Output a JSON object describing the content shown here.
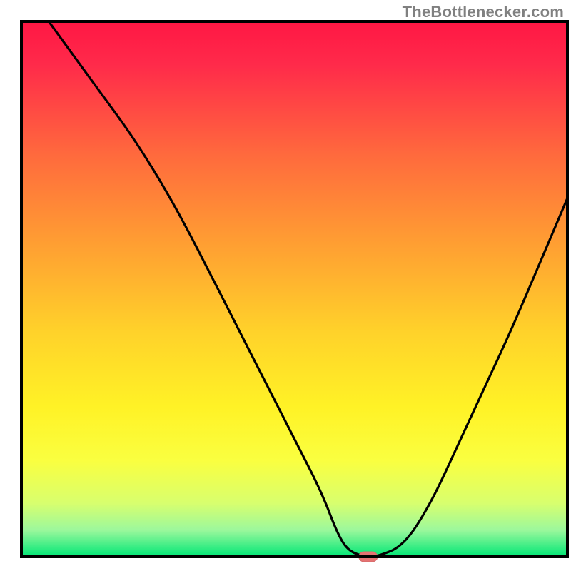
{
  "attribution": "TheBottlenecker.com",
  "chart_data": {
    "type": "line",
    "title": "",
    "xlabel": "",
    "ylabel": "",
    "xlim": [
      0,
      100
    ],
    "ylim": [
      0,
      100
    ],
    "x": [
      5,
      10,
      15,
      20,
      25,
      30,
      35,
      40,
      45,
      50,
      55,
      58,
      60,
      63,
      65,
      70,
      75,
      80,
      85,
      90,
      95,
      100
    ],
    "y": [
      100,
      93,
      86,
      79,
      71,
      62,
      52,
      42,
      32,
      22,
      12,
      4,
      1,
      0,
      0,
      2,
      10,
      21,
      32,
      43,
      55,
      67
    ],
    "marker": {
      "x": 63.5,
      "y": 0
    },
    "background_gradient": {
      "stops": [
        {
          "pos": 0.0,
          "color": "#ff1744"
        },
        {
          "pos": 0.08,
          "color": "#ff2a4a"
        },
        {
          "pos": 0.25,
          "color": "#ff6a3d"
        },
        {
          "pos": 0.42,
          "color": "#ffa032"
        },
        {
          "pos": 0.58,
          "color": "#ffd22a"
        },
        {
          "pos": 0.72,
          "color": "#fff226"
        },
        {
          "pos": 0.82,
          "color": "#faff40"
        },
        {
          "pos": 0.9,
          "color": "#d8ff6e"
        },
        {
          "pos": 0.95,
          "color": "#9cf89c"
        },
        {
          "pos": 1.0,
          "color": "#00e676"
        }
      ]
    },
    "colors": {
      "frame": "#000000",
      "line": "#000000",
      "marker_fill": "#e57373",
      "marker_stroke": "#d46a6a"
    }
  }
}
